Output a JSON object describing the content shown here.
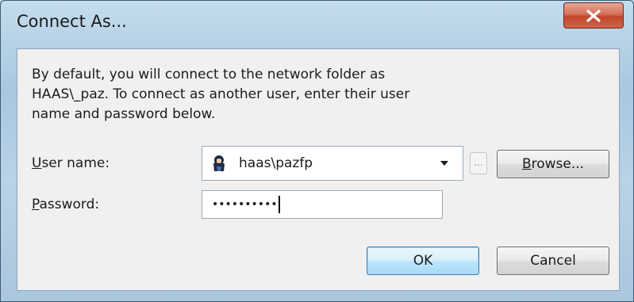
{
  "window": {
    "title": "Connect As..."
  },
  "titlebar": {
    "close_icon": "close-icon"
  },
  "dialog": {
    "intro_text": "By default, you will connect to the network folder as\nHAAS\\_paz. To connect as another user, enter their user\nname and password below.",
    "username_label_accel": "U",
    "username_label_rest": "ser name:",
    "username_value": "haas\\pazfp",
    "username_icon": "user-icon",
    "dropdown_icon": "chevron-down-icon",
    "ellipsis_label": "...",
    "browse_label_accel": "B",
    "browse_label_rest": "rowse...",
    "password_label_accel": "P",
    "password_label_rest": "assword:",
    "password_value": "••••••••••",
    "ok_label": "OK",
    "cancel_label": "Cancel"
  },
  "colors": {
    "close_button": "#c8503a",
    "default_button_border": "#3c7fb1",
    "client_background": "#f0f0f0"
  }
}
